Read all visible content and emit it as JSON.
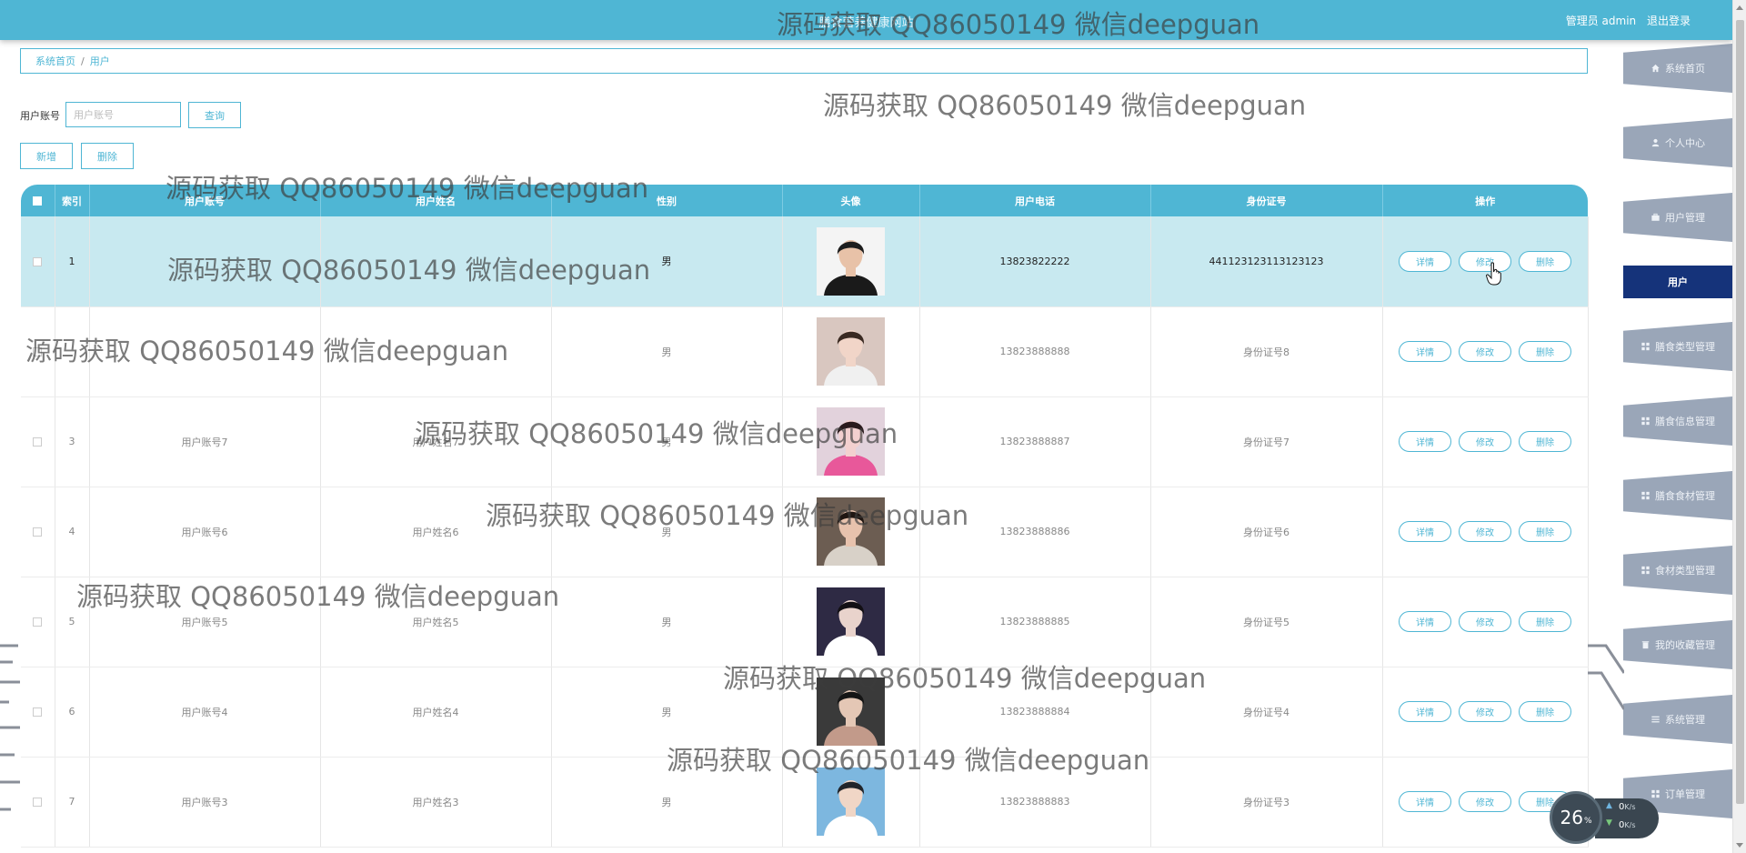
{
  "topbar": {
    "title": "膳食营养健康网站",
    "role_user": "管理员 admin",
    "logout": "退出登录"
  },
  "sidebar": {
    "items": [
      {
        "label": "系统首页",
        "icon": "home-icon"
      },
      {
        "label": "个人中心",
        "icon": "person-icon"
      },
      {
        "label": "用户管理",
        "icon": "briefcase-icon"
      },
      {
        "label": "用户",
        "icon": "",
        "active": true
      },
      {
        "label": "膳食类型管理",
        "icon": "grid-icon"
      },
      {
        "label": "膳食信息管理",
        "icon": "grid-icon"
      },
      {
        "label": "膳食食材管理",
        "icon": "grid-icon"
      },
      {
        "label": "食材类型管理",
        "icon": "grid-icon"
      },
      {
        "label": "我的收藏管理",
        "icon": "trash-icon"
      },
      {
        "label": "系统管理",
        "icon": "menu-icon"
      },
      {
        "label": "订单管理",
        "icon": "grid-icon"
      }
    ]
  },
  "breadcrumb": {
    "home": "系统首页",
    "separator": "/",
    "current": "用户"
  },
  "search": {
    "label": "用户账号",
    "placeholder": "用户账号",
    "button": "查询"
  },
  "actions": {
    "add": "新增",
    "delete": "删除"
  },
  "table": {
    "columns": [
      "索引",
      "用户账号",
      "用户姓名",
      "性别",
      "头像",
      "用户电话",
      "身份证号",
      "操作"
    ],
    "op_labels": {
      "detail": "详情",
      "edit": "修改",
      "delete": "删除"
    },
    "rows": [
      {
        "index": "1",
        "account": "",
        "name": "",
        "gender": "男",
        "phone": "13823822222",
        "idcard": "441123123113123123",
        "highlight": true
      },
      {
        "index": "",
        "account": "",
        "name": "",
        "gender": "男",
        "phone": "13823888888",
        "idcard": "身份证号8",
        "highlight": false
      },
      {
        "index": "3",
        "account": "用户账号7",
        "name": "用户姓名7",
        "gender": "男",
        "phone": "13823888887",
        "idcard": "身份证号7",
        "highlight": false
      },
      {
        "index": "4",
        "account": "用户账号6",
        "name": "用户姓名6",
        "gender": "男",
        "phone": "13823888886",
        "idcard": "身份证号6",
        "highlight": false
      },
      {
        "index": "5",
        "account": "用户账号5",
        "name": "用户姓名5",
        "gender": "男",
        "phone": "13823888885",
        "idcard": "身份证号5",
        "highlight": false
      },
      {
        "index": "6",
        "account": "用户账号4",
        "name": "用户姓名4",
        "gender": "男",
        "phone": "13823888884",
        "idcard": "身份证号4",
        "highlight": false
      },
      {
        "index": "7",
        "account": "用户账号3",
        "name": "用户姓名3",
        "gender": "男",
        "phone": "13823888883",
        "idcard": "身份证号3",
        "highlight": false
      }
    ]
  },
  "watermark": {
    "text": "源码获取 QQ86050149 微信deepguan"
  },
  "speed_widget": {
    "percent": "26",
    "percent_unit": "%",
    "up": "0",
    "down": "0",
    "unit": "K/s"
  },
  "colors": {
    "primary": "#4fb6d4",
    "sidebar_bg": "#9aa6b8",
    "sidebar_active": "#15337a",
    "row_highlight": "#c8e9f0"
  }
}
